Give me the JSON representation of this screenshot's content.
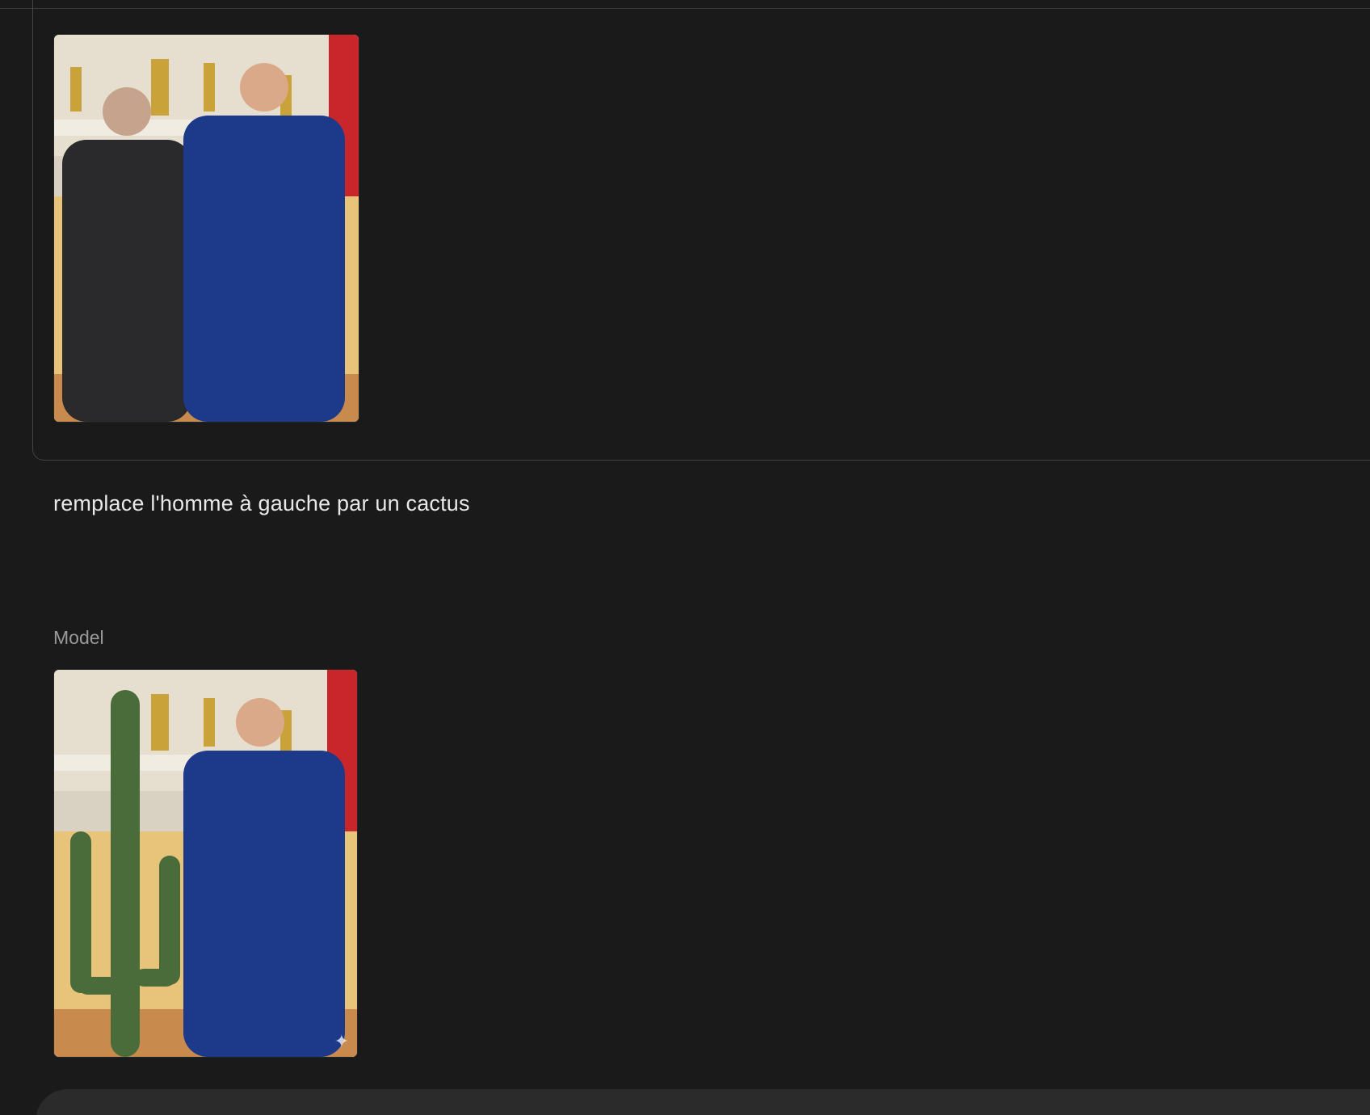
{
  "conversation": {
    "user_turn": {
      "image_description": "Photo of two people in suits standing side by side in an ornate room, giving a thumbs up",
      "prompt": "remplace l'homme à gauche par un cactus"
    },
    "model_turn": {
      "label": "Model",
      "image_description": "Edited photo: a tall saguaro cactus stands on the left beside a person in a blue suit giving a thumbs up",
      "sparkle_icon": "sparkle-icon"
    }
  },
  "colors": {
    "background": "#1a1a1a",
    "text": "#e8e8e8",
    "muted_text": "#9a9a9a",
    "border": "#444444",
    "composer": "#2b2b2b"
  }
}
